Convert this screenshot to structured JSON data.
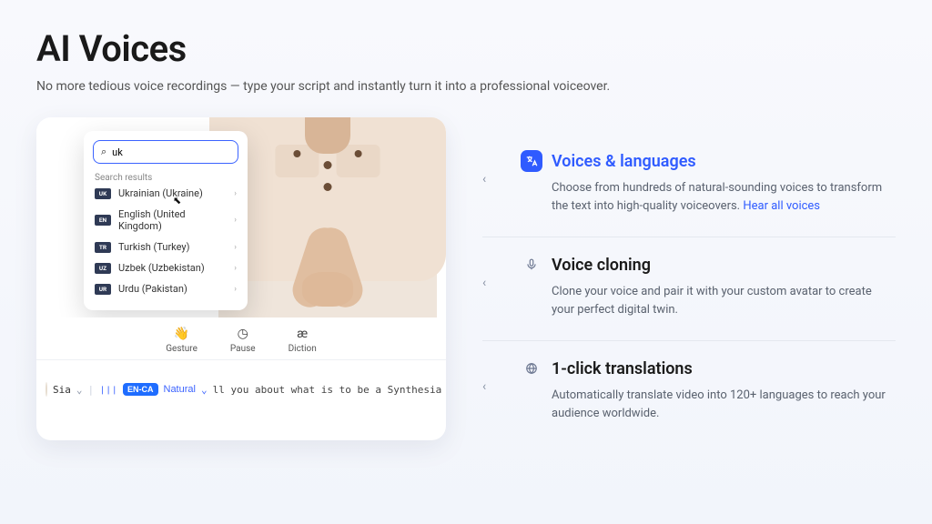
{
  "header": {
    "title": "AI Voices",
    "subtitle": "No more tedious voice recordings — type your script and instantly turn it into a professional voiceover."
  },
  "search": {
    "query": "uk",
    "results_header": "Search results",
    "results": [
      {
        "code": "UK",
        "label": "Ukrainian (Ukraine)"
      },
      {
        "code": "EN",
        "label": "English (United Kingdom)"
      },
      {
        "code": "TR",
        "label": "Turkish (Turkey)"
      },
      {
        "code": "UZ",
        "label": "Uzbek (Uzbekistan)"
      },
      {
        "code": "UR",
        "label": "Urdu (Pakistan)"
      }
    ]
  },
  "toolbar": {
    "gesture": "Gesture",
    "pause": "Pause",
    "diction": "Diction"
  },
  "script_row": {
    "voice_name": "Sia",
    "lang_tag": "EN-CA",
    "style": "Natural",
    "text": "ll you about what is to be a Synthesia avatar"
  },
  "features": [
    {
      "icon": "translate-icon",
      "title": "Voices & languages",
      "desc": "Choose from hundreds of natural-sounding voices to transform the text into high-quality voiceovers. ",
      "link": "Hear all voices",
      "active": true
    },
    {
      "icon": "microphone-icon",
      "title": "Voice cloning",
      "desc": "Clone your voice and pair it with your custom avatar to create your perfect digital twin.",
      "link": "",
      "active": false
    },
    {
      "icon": "globe-icon",
      "title": "1-click translations",
      "desc": "Automatically translate video into 120+ languages to reach your audience worldwide.",
      "link": "",
      "active": false
    }
  ],
  "icons": {
    "search": "⌕",
    "chevron_right": "›",
    "chevron_left": "‹",
    "cursor": "↖",
    "gesture": "✋",
    "pause": "◯",
    "diction": "æ",
    "wave": "⦾",
    "dropdown": "⌄",
    "translate": "🔤",
    "mic": "🎤",
    "globe": "🌐"
  }
}
